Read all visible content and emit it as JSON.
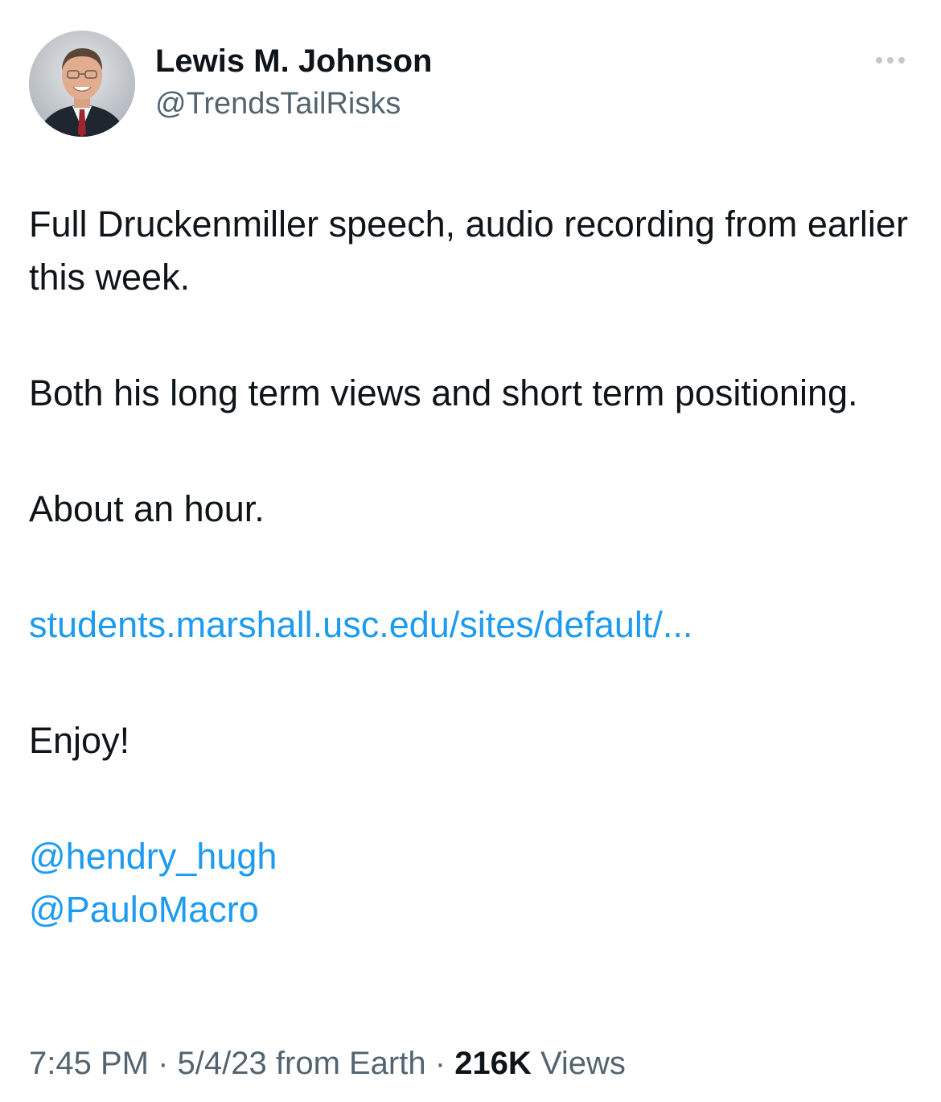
{
  "author": {
    "name": "Lewis M. Johnson",
    "handle": "@TrendsTailRisks"
  },
  "icons": {
    "more": "more-horizontal-icon"
  },
  "tweet": {
    "paragraph_1": "Full Druckenmiller speech, audio recording from earlier this week.",
    "paragraph_2": "Both his long term views and short term positioning.",
    "paragraph_3": "About an hour.",
    "link_text": "students.marshall.usc.edu/sites/default/...",
    "paragraph_4": "Enjoy!",
    "mentions": [
      "@hendry_hugh",
      "@PauloMacro"
    ]
  },
  "meta": {
    "time": "7:45 PM",
    "date": "5/4/23",
    "source": "from Earth",
    "separator": "·",
    "views_count": "216K",
    "views_label": "Views"
  },
  "colors": {
    "link": "#1d9bf0",
    "text": "#0f1419",
    "secondary": "#536471"
  }
}
